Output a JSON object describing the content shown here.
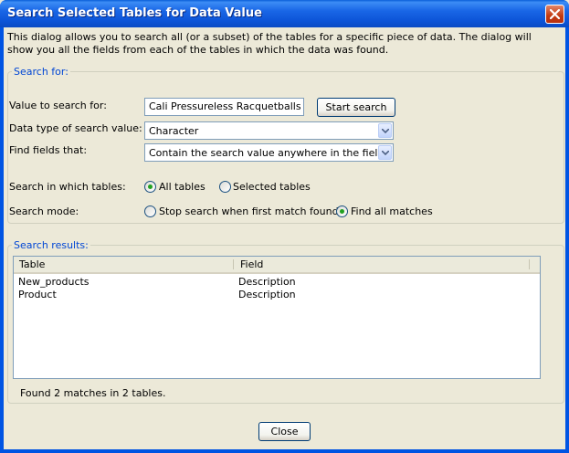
{
  "window": {
    "title": "Search Selected Tables for Data Value"
  },
  "intro": "This dialog allows you to search all (or a subset) of the tables for a specific piece of data. The dialog will show you all the fields from each of the tables in which the data was found.",
  "search_for": {
    "legend": "Search for:",
    "value_label": "Value to search for:",
    "value": "Cali Pressureless Racquetballs",
    "start_button": "Start search",
    "datatype_label": "Data type of search value:",
    "datatype_value": "Character",
    "find_fields_label": "Find fields that:",
    "find_fields_value": "Contain the search value anywhere in the field",
    "tables_label": "Search in which tables:",
    "tables_all": "All tables",
    "tables_selected": "Selected tables",
    "mode_label": "Search mode:",
    "mode_stop": "Stop search when first match found",
    "mode_all": "Find all matches"
  },
  "results": {
    "legend": "Search results:",
    "columns": [
      "Table",
      "Field"
    ],
    "rows": [
      [
        "New_products",
        "Description"
      ],
      [
        "Product",
        "Description"
      ]
    ],
    "status": "Found 2 matches in 2 tables."
  },
  "close_button": "Close",
  "colors": {
    "titlebar": "#0054e3",
    "legend_text": "#0046d5",
    "close_x": "#c2390f",
    "radio_dot": "#21a121"
  }
}
